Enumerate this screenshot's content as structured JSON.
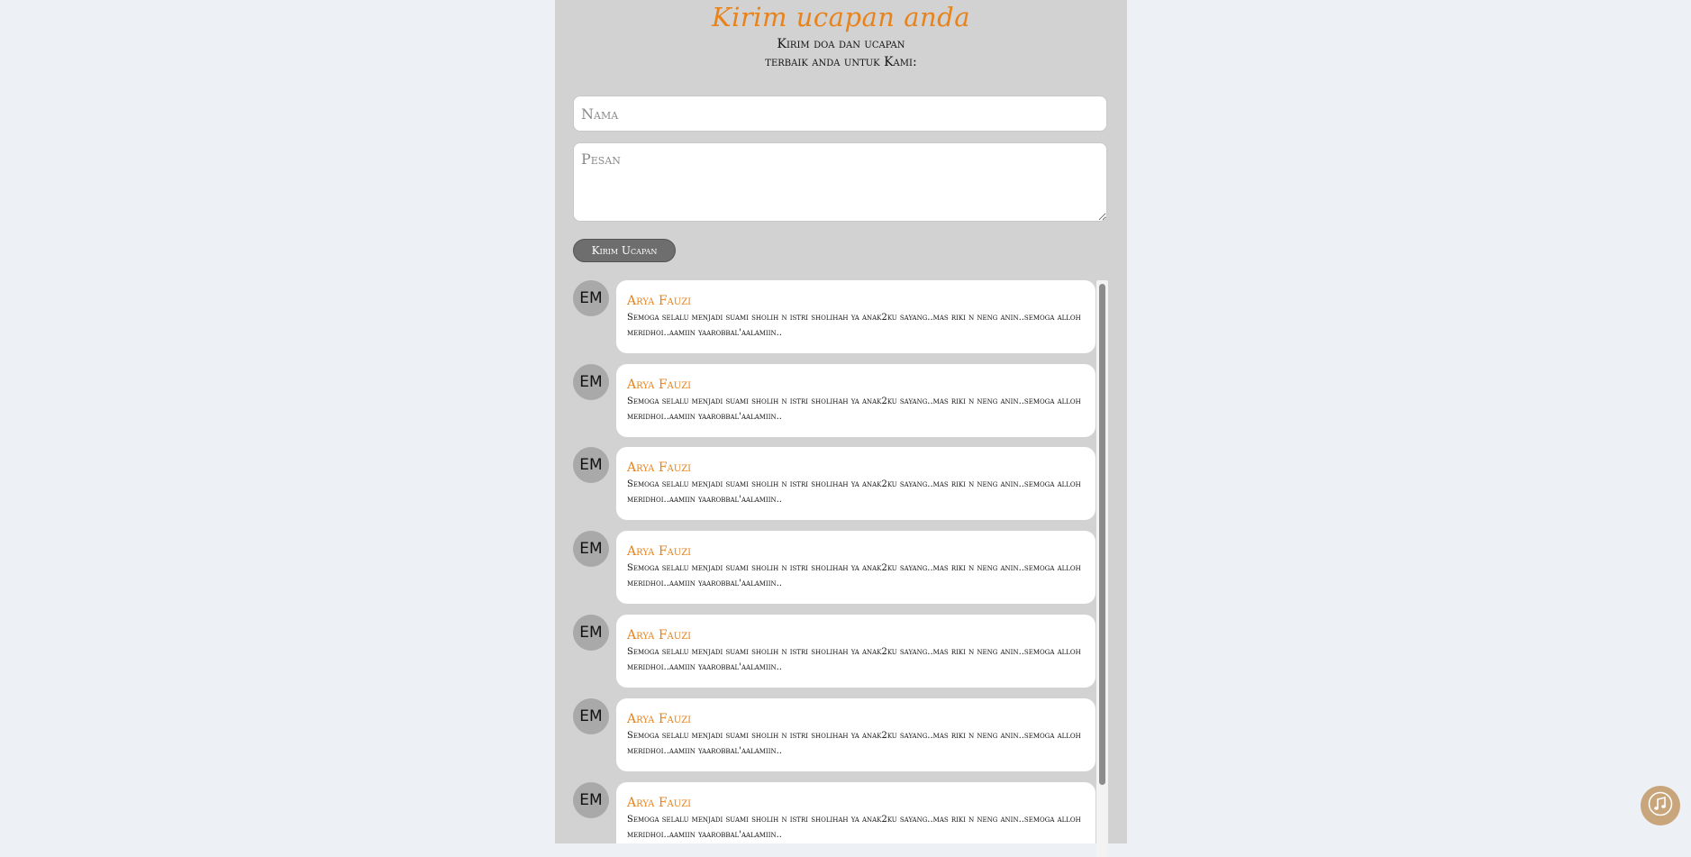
{
  "form": {
    "title": "Kirim ucapan anda",
    "subtitle_line1": "Kirim doa dan ucapan",
    "subtitle_line2": "terbaik anda untuk Kami:",
    "name_placeholder": "Nama",
    "message_placeholder": "Pesan",
    "submit_label": "Kirim Ucapan"
  },
  "comments": [
    {
      "avatar": "EM",
      "name": "Arya Fauzi",
      "message": "Semoga selalu menjadi suami sholih n istri sholihah ya anak2ku sayang..mas riki n neng anin..semoga alloh meridhoi..aamiin yaarobbal'aalamiin.."
    },
    {
      "avatar": "EM",
      "name": "Arya Fauzi",
      "message": "Semoga selalu menjadi suami sholih n istri sholihah ya anak2ku sayang..mas riki n neng anin..semoga alloh meridhoi..aamiin yaarobbal'aalamiin.."
    },
    {
      "avatar": "EM",
      "name": "Arya Fauzi",
      "message": "Semoga selalu menjadi suami sholih n istri sholihah ya anak2ku sayang..mas riki n neng anin..semoga alloh meridhoi..aamiin yaarobbal'aalamiin.."
    },
    {
      "avatar": "EM",
      "name": "Arya Fauzi",
      "message": "Semoga selalu menjadi suami sholih n istri sholihah ya anak2ku sayang..mas riki n neng anin..semoga alloh meridhoi..aamiin yaarobbal'aalamiin.."
    },
    {
      "avatar": "EM",
      "name": "Arya Fauzi",
      "message": "Semoga selalu menjadi suami sholih n istri sholihah ya anak2ku sayang..mas riki n neng anin..semoga alloh meridhoi..aamiin yaarobbal'aalamiin.."
    },
    {
      "avatar": "EM",
      "name": "Arya Fauzi",
      "message": "Semoga selalu menjadi suami sholih n istri sholihah ya anak2ku sayang..mas riki n neng anin..semoga alloh meridhoi..aamiin yaarobbal'aalamiin.."
    },
    {
      "avatar": "EM",
      "name": "Arya Fauzi",
      "message": "Semoga selalu menjadi suami sholih n istri sholihah ya anak2ku sayang..mas riki n neng anin..semoga alloh meridhoi..aamiin yaarobbal'aalamiin.."
    }
  ],
  "music_button": {
    "icon": "music-note-icon"
  },
  "colors": {
    "page_background": "#edf1f6",
    "panel_background": "#d2d2d2",
    "accent": "#e8821a",
    "button": "#6e6e6e",
    "music_button": "#c9a57b"
  }
}
